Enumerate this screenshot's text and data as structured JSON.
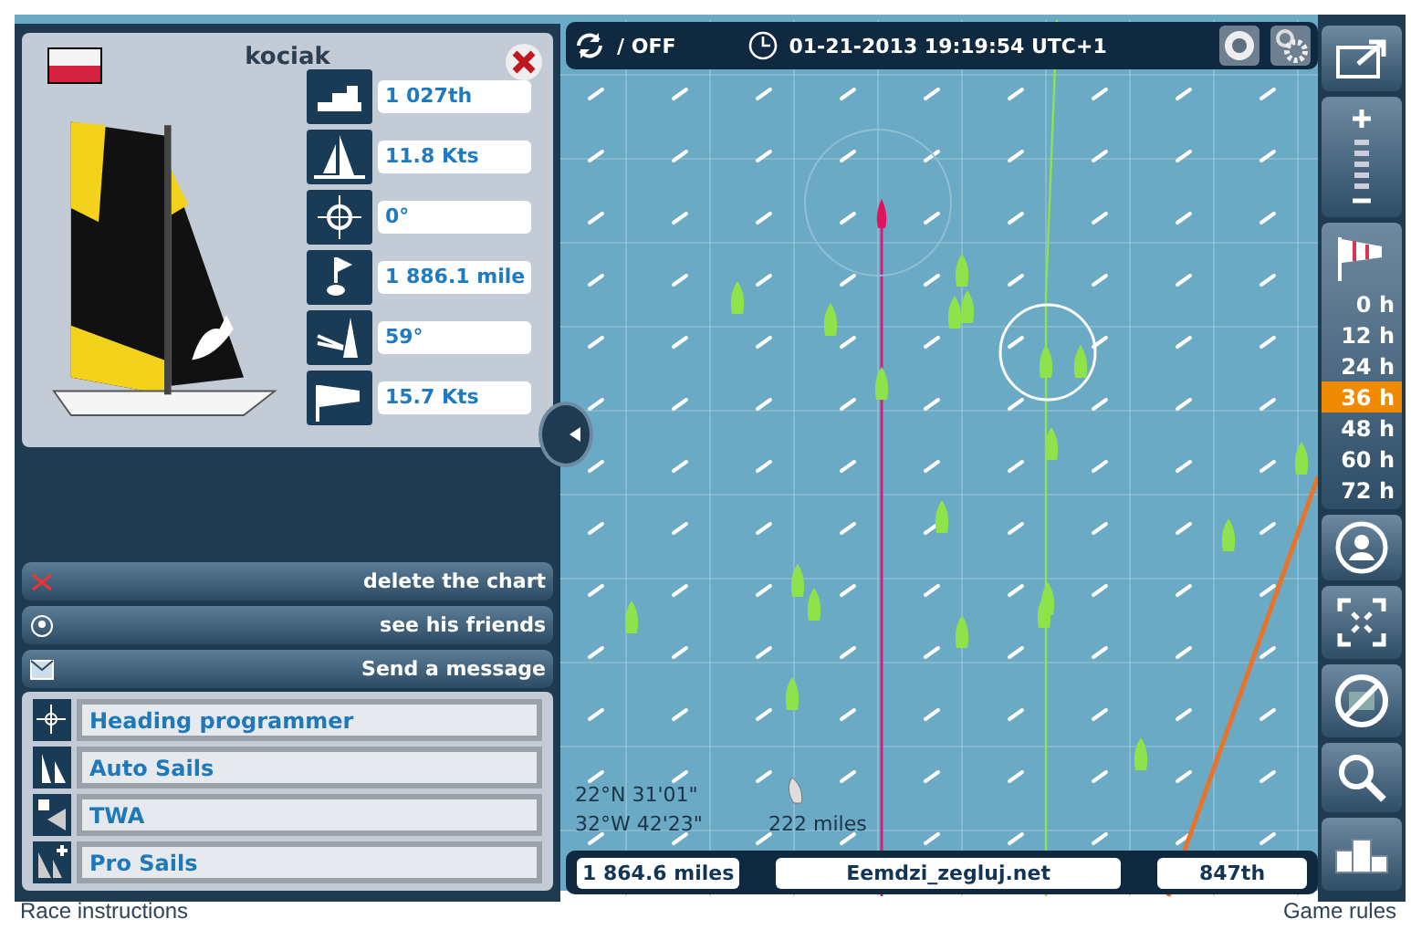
{
  "boat_card": {
    "name": "kociak",
    "stats": [
      {
        "kind": "rank",
        "value": "1 027th"
      },
      {
        "kind": "speed",
        "value": "11.8 Kts"
      },
      {
        "kind": "heading",
        "value": "0°"
      },
      {
        "kind": "distance",
        "value": "1 886.1 mile"
      },
      {
        "kind": "wind_angle",
        "value": "59°"
      },
      {
        "kind": "wind_speed",
        "value": "15.7 Kts"
      }
    ]
  },
  "actions": [
    {
      "kind": "delete",
      "label": "delete the chart"
    },
    {
      "kind": "friends",
      "label": "see his friends"
    },
    {
      "kind": "message",
      "label": "Send a message"
    }
  ],
  "options": [
    {
      "kind": "heading",
      "label": "Heading programmer"
    },
    {
      "kind": "auto_sails",
      "label": "Auto Sails"
    },
    {
      "kind": "twa",
      "label": "TWA"
    },
    {
      "kind": "pro_sails",
      "label": "Pro Sails"
    }
  ],
  "top_bar": {
    "sync": "/ OFF",
    "datetime": "01-21-2013 19:19:54 UTC+1"
  },
  "map": {
    "latitude": "22°N 31'01\"",
    "longitude": "32°W 42'23\"",
    "distance": "222 miles"
  },
  "bottom_bar": {
    "distance": "1 864.6 miles",
    "player": "Eemdzi_zegluj.net",
    "rank": "847th"
  },
  "forecast": [
    {
      "label": "0 h",
      "selected": false
    },
    {
      "label": "12 h",
      "selected": false
    },
    {
      "label": "24 h",
      "selected": false
    },
    {
      "label": "36 h",
      "selected": true
    },
    {
      "label": "48 h",
      "selected": false
    },
    {
      "label": "60 h",
      "selected": false
    },
    {
      "label": "72 h",
      "selected": false
    }
  ],
  "footer": {
    "left": "Race instructions",
    "right": "Game rules"
  }
}
